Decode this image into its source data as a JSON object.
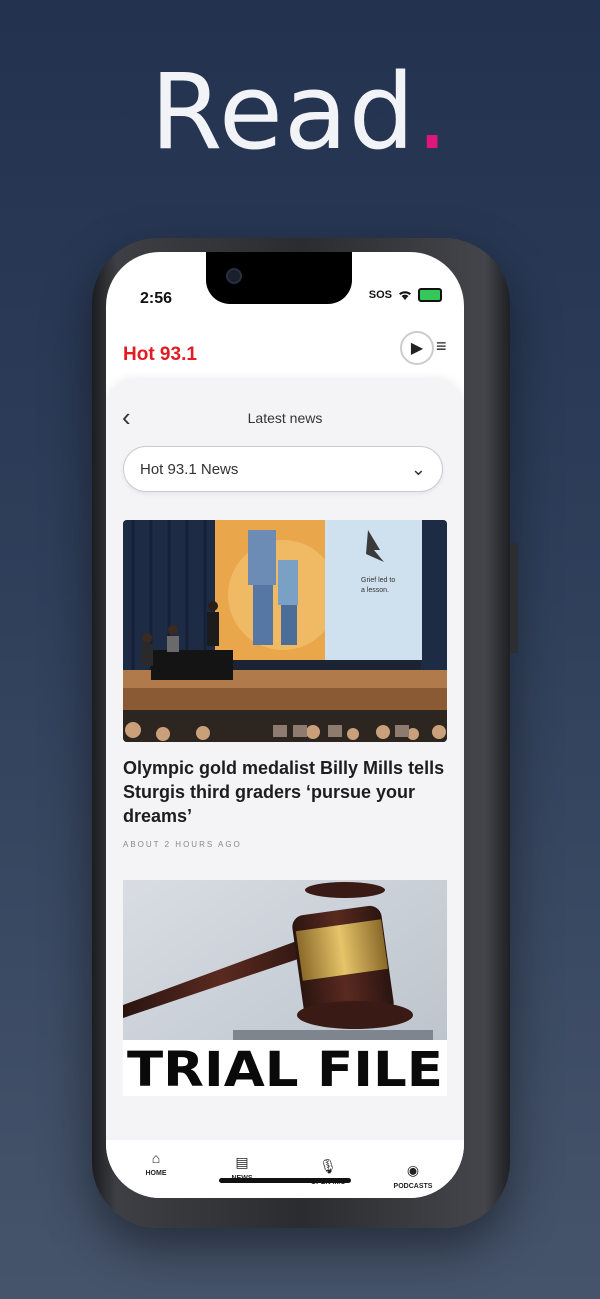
{
  "hero": {
    "word": "Read",
    "dot": "."
  },
  "status": {
    "time": "2:56",
    "sos": "SOS"
  },
  "app": {
    "logo": "Hot 93.1",
    "play_icon": "▶",
    "menu_icon": "≡"
  },
  "page": {
    "back_icon": "‹",
    "title": "Latest news",
    "dropdown_value": "Hot 93.1 News",
    "dropdown_icon": "⌄"
  },
  "articles": [
    {
      "title": "Olympic gold medalist Billy Mills tells Sturgis third graders ‘pursue your dreams’",
      "meta": "ABOUT 2 HOURS AGO",
      "slide_text": "Grief led to a lesson."
    },
    {
      "image_caption": "TRIAL FILE"
    }
  ],
  "tabs": [
    {
      "label": "HOME",
      "icon": "⌂"
    },
    {
      "label": "NEWS",
      "icon": "▤"
    },
    {
      "label": "OPEN MIC",
      "icon": "🎙"
    },
    {
      "label": "PODCASTS",
      "icon": "◉"
    }
  ],
  "colors": {
    "accent": "#e0177a",
    "logo": "#e31b23",
    "bg_top": "#23324f"
  }
}
